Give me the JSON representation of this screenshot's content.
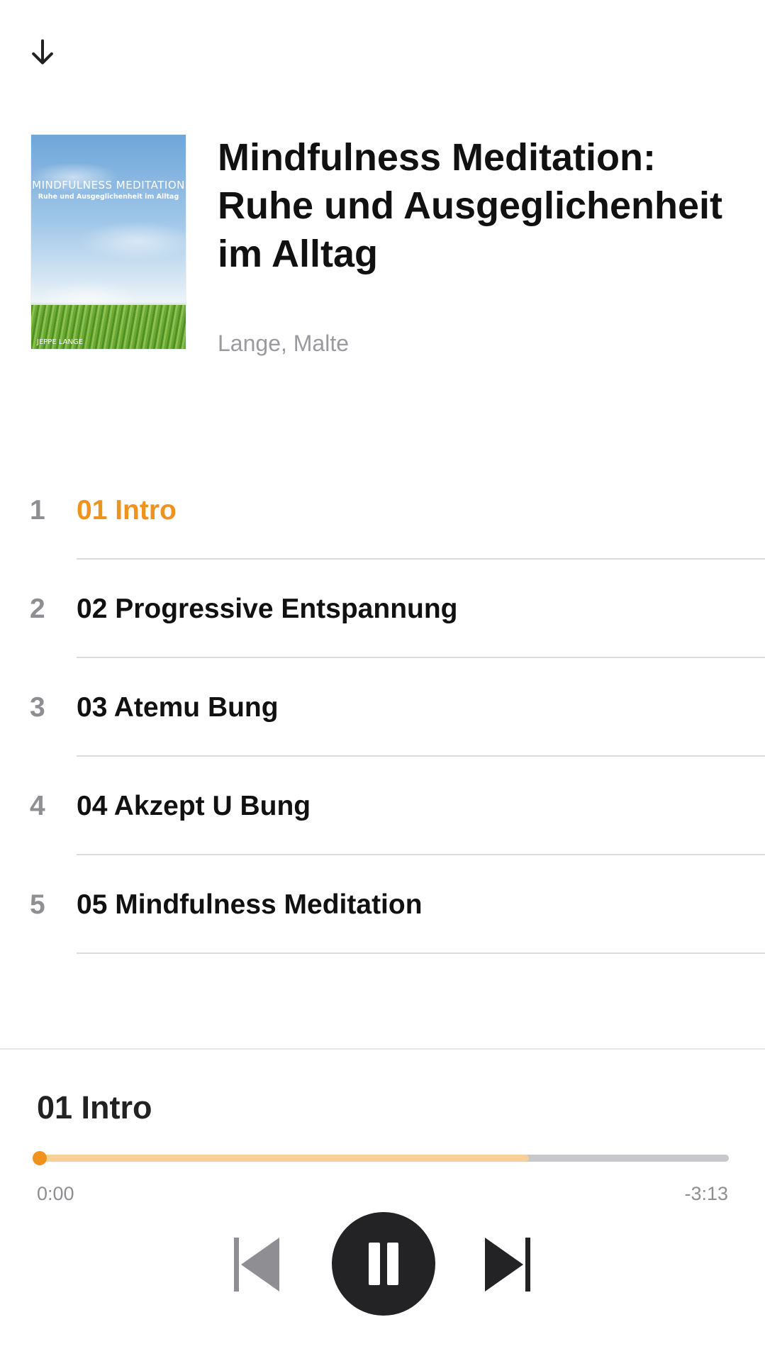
{
  "header": {
    "collapse_icon": "arrow-down-icon"
  },
  "book": {
    "title": "Mindfulness Meditation: Ruhe und Ausgeglichenheit im Alltag",
    "author": "Lange, Malte",
    "cover": {
      "title": "MINDFULNESS MEDITATION",
      "subtitle": "Ruhe und Ausgeglichenheit im Alltag",
      "author": "JEPPE LANGE"
    }
  },
  "tracks": [
    {
      "number": "1",
      "name": "01 Intro",
      "active": true
    },
    {
      "number": "2",
      "name": "02 Progressive Entspannung",
      "active": false
    },
    {
      "number": "3",
      "name": "03 Atemu Bung",
      "active": false
    },
    {
      "number": "4",
      "name": "04 Akzept U Bung",
      "active": false
    },
    {
      "number": "5",
      "name": "05 Mindfulness Meditation",
      "active": false
    }
  ],
  "player": {
    "current_track": "01 Intro",
    "elapsed": "0:00",
    "remaining": "-3:13",
    "playback_progress": 0,
    "buffered_progress": 0.71,
    "state": "playing",
    "icons": {
      "previous": "skip-back-icon",
      "toggle": "pause-icon",
      "next": "skip-forward-icon"
    }
  },
  "colors": {
    "accent": "#f0921e",
    "buffer": "#f6cf9a",
    "track_bg": "#c7c7cc",
    "button": "#232326"
  }
}
